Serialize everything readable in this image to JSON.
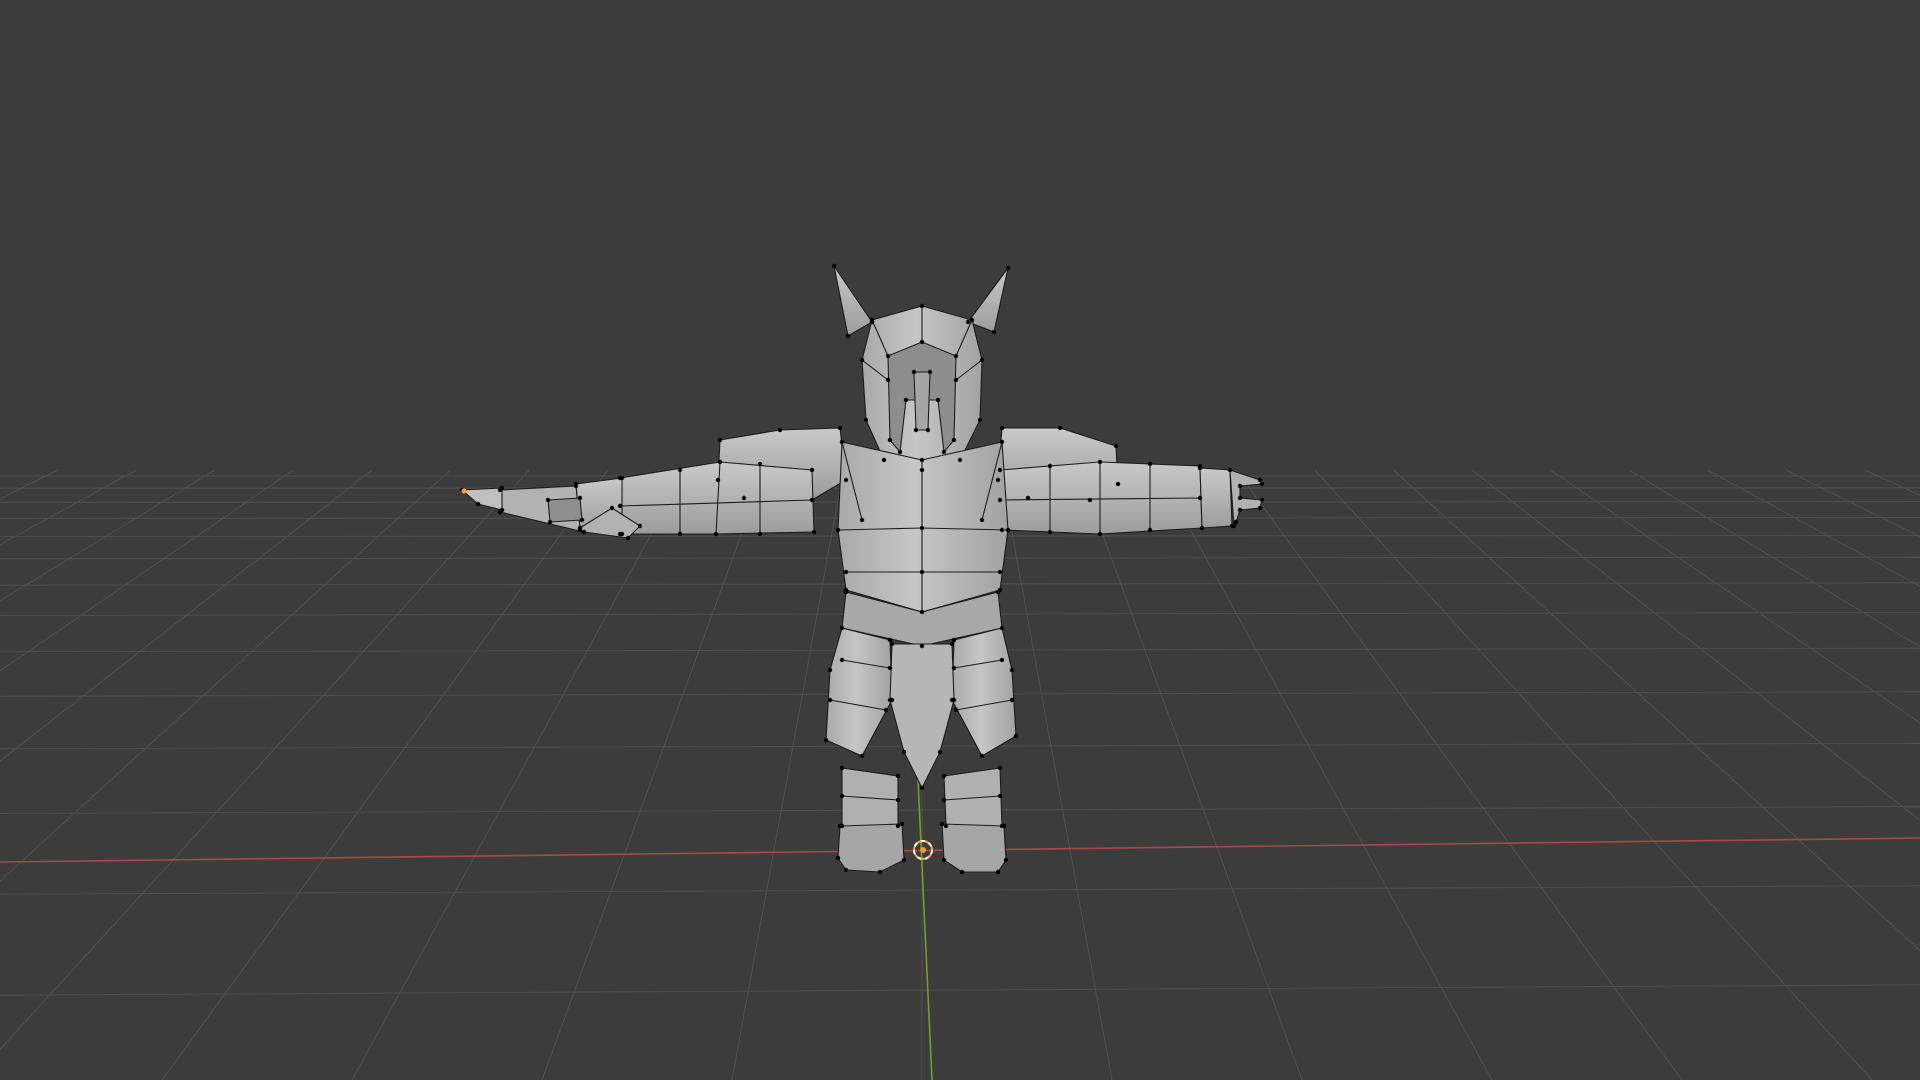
{
  "viewport": {
    "background": "#3c3c3c",
    "grid_color": "#505050",
    "x_axis_color": "#a84848",
    "y_axis_color": "#7a9a2a",
    "mesh_fill": "#bdbdbd",
    "mesh_shade": "#9e9e9e",
    "mesh_edge": "#1a1a1a",
    "vertex_color": "#000000",
    "origin_color": "#f09a40",
    "selected_vertex_color": "#ff9a30"
  },
  "scene": {
    "object": "knight-mesh",
    "mode": "edit",
    "pose": "t-pose",
    "icons": [
      "3d-cursor-icon",
      "object-origin-icon"
    ]
  }
}
